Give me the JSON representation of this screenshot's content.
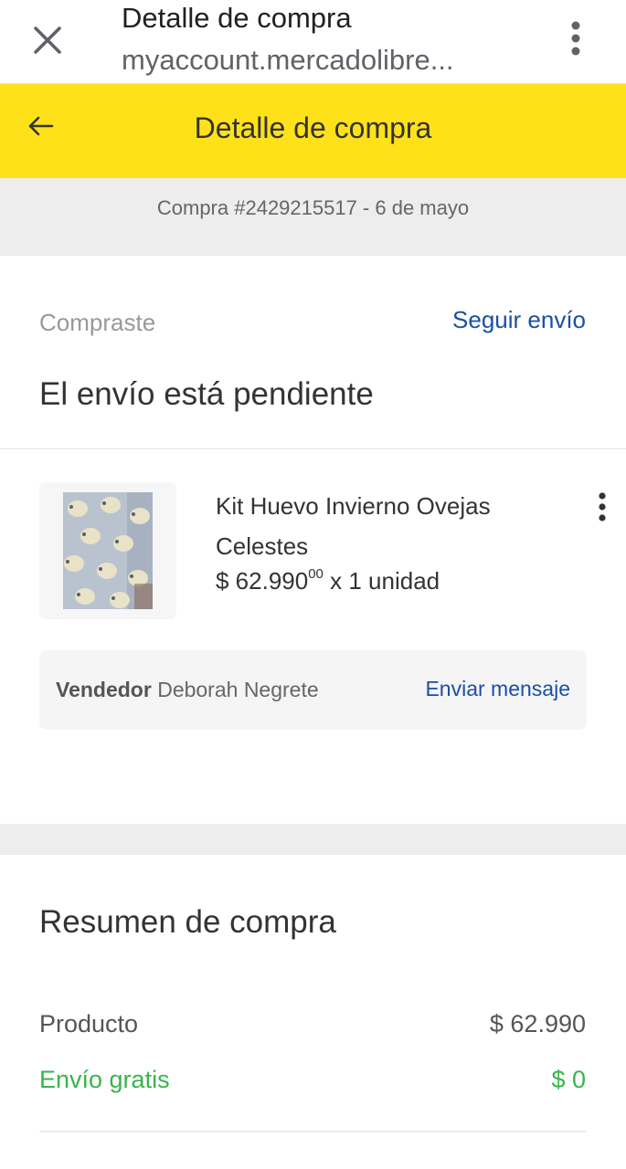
{
  "browser": {
    "title": "Detalle de compra",
    "url": "myaccount.mercadolibre..."
  },
  "header": {
    "title": "Detalle de compra",
    "back_icon": "arrow-left-icon",
    "accent_color": "#ffe11a"
  },
  "order": {
    "id_text": "Compra #2429215517 - 6 de mayo"
  },
  "status": {
    "label": "Compraste",
    "track_link": "Seguir envío",
    "title": "El envío está pendiente"
  },
  "item": {
    "name": "Kit Huevo Invierno Ovejas Celestes",
    "price_main": "$ 62.990",
    "price_cents": "00",
    "quantity": " x 1 unidad"
  },
  "seller": {
    "label": "Vendedor",
    "name": " Deborah Negrete",
    "message_link": "Enviar mensaje"
  },
  "summary": {
    "title": "Resumen de compra",
    "product_label": "Producto",
    "product_value": "$ 62.990",
    "shipping_label": "Envío gratis",
    "shipping_value": "$ 0",
    "shipping_color": "#39b54a"
  },
  "colors": {
    "link": "#1a4fa6",
    "band": "#ededed"
  }
}
